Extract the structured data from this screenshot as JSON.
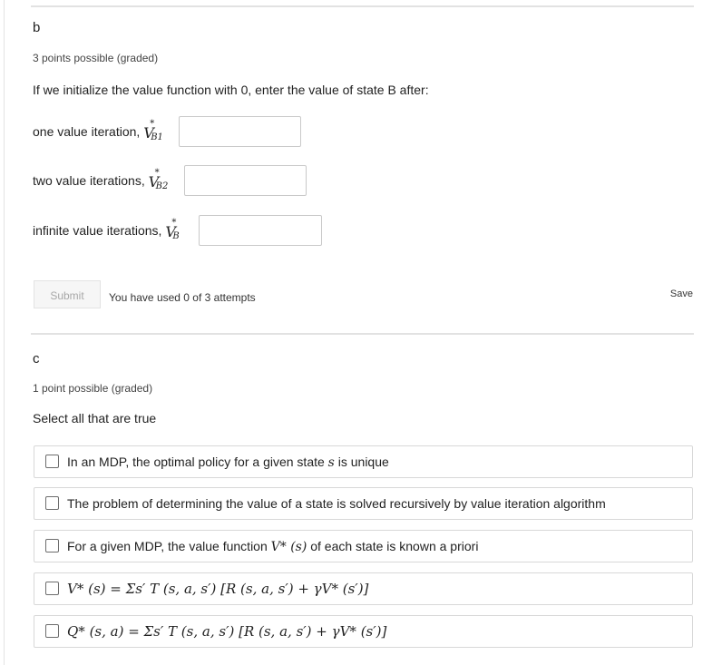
{
  "part_b": {
    "title": "b",
    "meta": "3 points possible (graded)",
    "prompt": "If we initialize the value function with 0, enter the value of state B after:",
    "fields": [
      {
        "label": "one value iteration,",
        "var": "V",
        "sup": "*",
        "sub": "B1",
        "value": ""
      },
      {
        "label": "two value iterations,",
        "var": "V",
        "sup": "*",
        "sub": "B2",
        "value": ""
      },
      {
        "label": "infinite value iterations,",
        "var": "V",
        "sup": "*",
        "sub": "B",
        "value": ""
      }
    ],
    "submit_label": "Submit",
    "attempts_text": "You have used 0 of 3 attempts",
    "save_label": "Save"
  },
  "part_c": {
    "title": "c",
    "meta": "1 point possible (graded)",
    "prompt": "Select all that are true",
    "choices": [
      {
        "text_before": "In an MDP, the optimal policy for a given state ",
        "math": "s",
        "text_after": " is unique",
        "checked": false
      },
      {
        "text_before": "The problem of determining the value of a state is solved recursively by value iteration algorithm",
        "math": "",
        "text_after": "",
        "checked": false
      },
      {
        "text_before": "For a given MDP, the value function ",
        "math": "V* (s)",
        "text_after": " of each state is known a priori",
        "checked": false
      },
      {
        "text_before": "",
        "math": "V* (s) = Σs′ T (s, a, s′) [R (s, a, s′) + γV* (s′)]",
        "text_after": "",
        "checked": false
      },
      {
        "text_before": "",
        "math": "Q* (s, a) = Σs′ T (s, a, s′) [R (s, a, s′) + γV* (s′)]",
        "text_after": "",
        "checked": false
      }
    ]
  }
}
